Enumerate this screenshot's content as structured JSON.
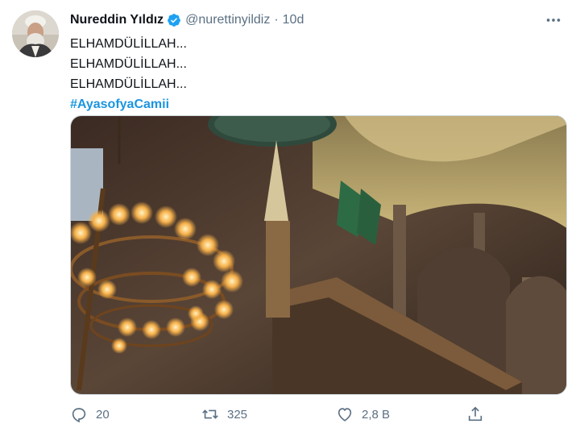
{
  "tweet": {
    "author_name": "Nureddin Yıldız",
    "handle": "@nurettinyildiz",
    "separator": "·",
    "time": "10d",
    "lines": [
      "ELHAMDÜLİLLAH...",
      "ELHAMDÜLİLLAH...",
      "ELHAMDÜLİLLAH..."
    ],
    "hashtag": "#AyasofyaCamii"
  },
  "actions": {
    "reply_count": "20",
    "retweet_count": "325",
    "like_count": "2,8 B",
    "share_icon": "share-icon"
  },
  "colors": {
    "text": "#0f1419",
    "secondary": "#5b7083",
    "link": "#1b95e0",
    "verified": "#1da1f2"
  }
}
